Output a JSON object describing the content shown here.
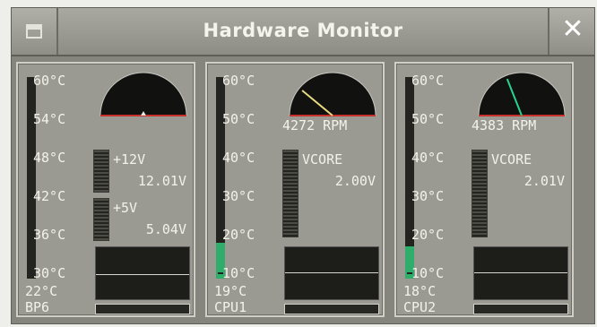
{
  "window": {
    "title": "Hardware Monitor",
    "menu_icon": "window-menu-icon",
    "close_icon": "close-icon",
    "close_glyph": "✕"
  },
  "panels": [
    {
      "name": "BP6",
      "current_temp": "22°C",
      "temp_ticks": [
        "60°C",
        "54°C",
        "48°C",
        "42°C",
        "36°C",
        "30°C"
      ],
      "bar_level": 0.0,
      "voltages": [
        {
          "label": "+12V",
          "value": "12.01V"
        },
        {
          "label": "+5V",
          "value": "5.04V"
        }
      ]
    },
    {
      "name": "CPU1",
      "current_temp": "19°C",
      "temp_ticks": [
        "60°C",
        "50°C",
        "40°C",
        "30°C",
        "20°C",
        "10°C"
      ],
      "bar_level": 0.18,
      "rpm": "4272 RPM",
      "rpm_fraction": 0.22,
      "needle_color": "#e6d980",
      "voltages": [
        {
          "label": "VCORE",
          "value": "2.00V"
        }
      ]
    },
    {
      "name": "CPU2",
      "current_temp": "18°C",
      "temp_ticks": [
        "60°C",
        "50°C",
        "40°C",
        "30°C",
        "20°C",
        "10°C"
      ],
      "bar_level": 0.16,
      "rpm": "4383 RPM",
      "rpm_fraction": 0.38,
      "needle_color": "#27d48f",
      "voltages": [
        {
          "label": "VCORE",
          "value": "2.01V"
        }
      ]
    }
  ],
  "colors": {
    "bar_fill": "#2eae6a",
    "gauge_red": "#c8312b",
    "panel_bg": "#9a9a92"
  }
}
